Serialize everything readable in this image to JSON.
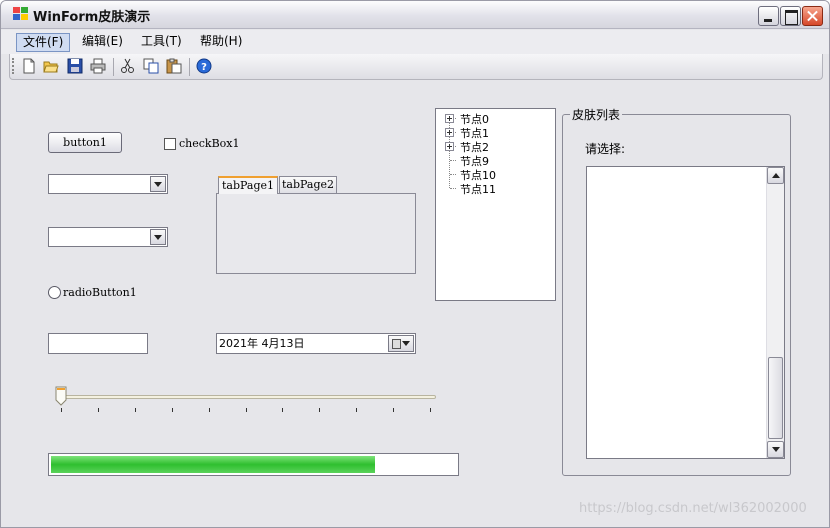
{
  "window": {
    "title": "WinForm皮肤演示"
  },
  "menu": {
    "items": [
      "文件(F)",
      "编辑(E)",
      "工具(T)",
      "帮助(H)"
    ]
  },
  "toolbar": {
    "icons": [
      "new-file-icon",
      "open-folder-icon",
      "save-icon",
      "print-icon",
      "cut-icon",
      "copy-icon",
      "paste-icon",
      "help-icon"
    ]
  },
  "controls": {
    "button1_label": "button1",
    "checkbox1_label": "checkBox1",
    "radio1_label": "radioButton1",
    "tabs": [
      "tabPage1",
      "tabPage2"
    ],
    "date_value": "2021年 4月13日",
    "textbox_value": "",
    "combo1_value": "",
    "combo2_value": "",
    "progress_fraction": 0.8,
    "slider_value_fraction": 0.0
  },
  "tree": {
    "nodes": [
      {
        "label": "节点0",
        "expandable": true
      },
      {
        "label": "节点1",
        "expandable": true
      },
      {
        "label": "节点2",
        "expandable": true
      },
      {
        "label": "节点9",
        "expandable": false
      },
      {
        "label": "节点10",
        "expandable": false
      },
      {
        "label": "节点11",
        "expandable": false
      }
    ]
  },
  "skin_panel": {
    "title": "皮肤列表",
    "prompt": "请选择:",
    "items": []
  },
  "watermark": "https://blog.csdn.net/wl362002000",
  "colors": {
    "progress": "#2fbf2f",
    "close_button": "#d6482a",
    "tab_highlight": "#f0a030"
  }
}
